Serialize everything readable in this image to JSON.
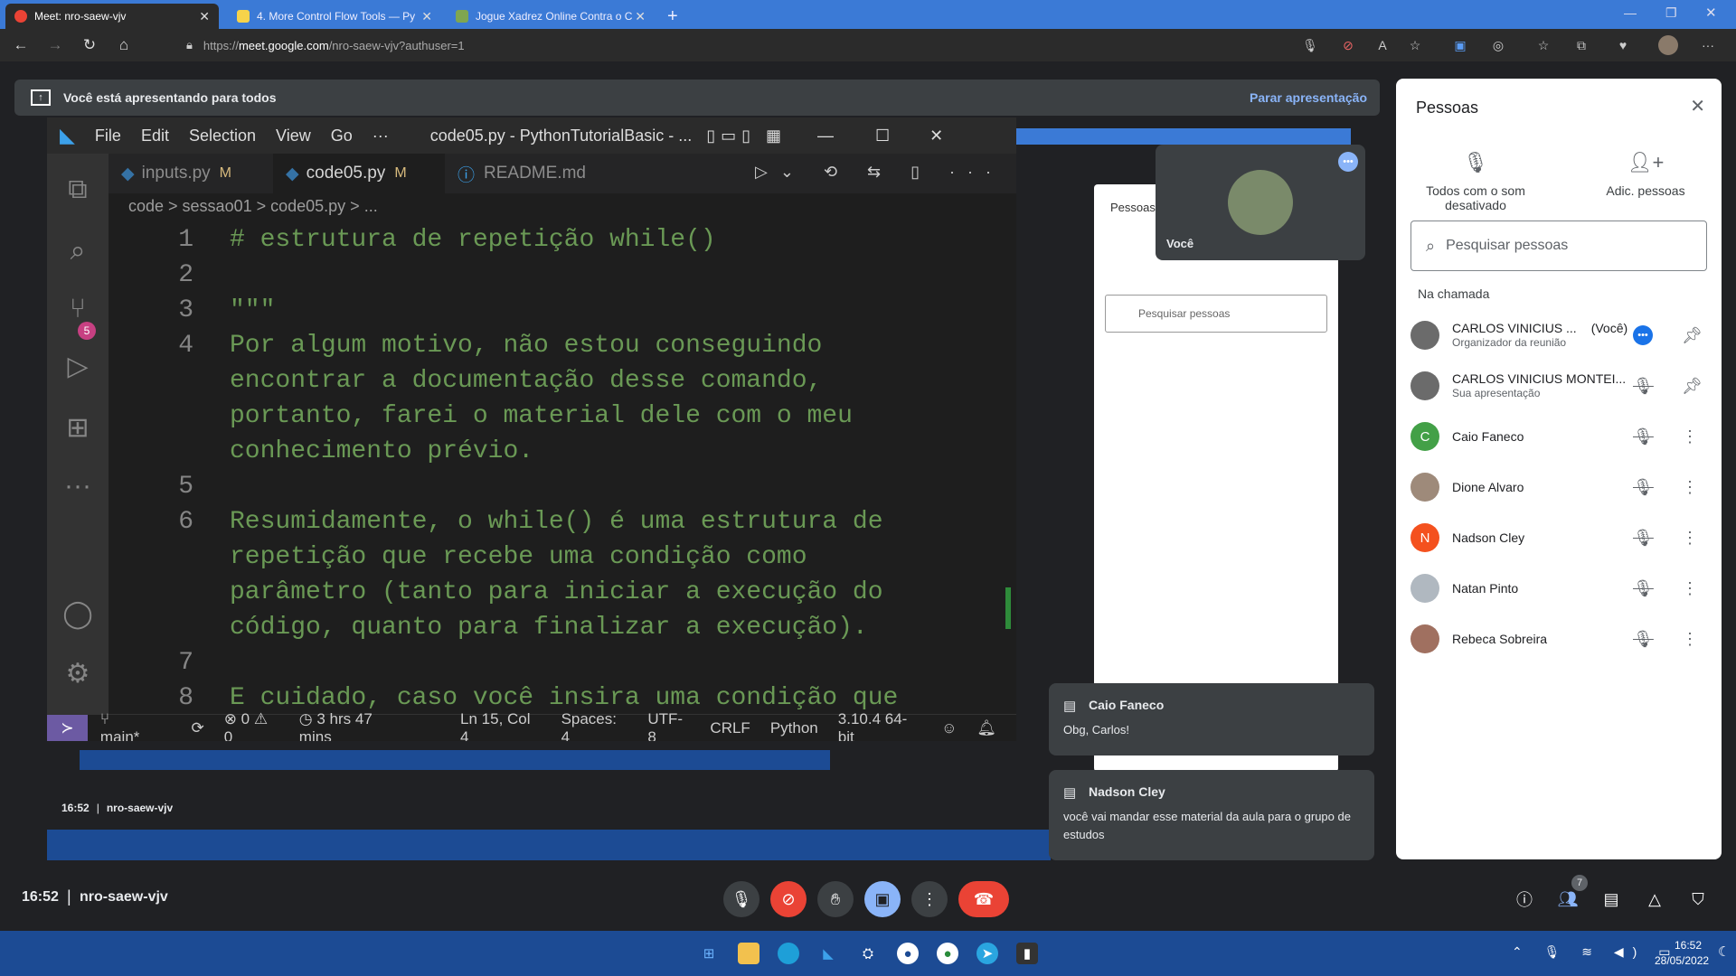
{
  "browser": {
    "tabs": [
      {
        "title": "Meet: nro-saew-vjv",
        "active": true
      },
      {
        "title": "4. More Control Flow Tools — Py"
      },
      {
        "title": "Jogue Xadrez Online Contra o C"
      }
    ],
    "url_prefix": "https://",
    "url_domain": "meet.google.com",
    "url_path": "/nro-saew-vjv?authuser=1"
  },
  "banner": {
    "text": "Você está apresentando para todos",
    "stop": "Parar apresentação"
  },
  "vscode": {
    "menu": [
      "File",
      "Edit",
      "Selection",
      "View",
      "Go",
      "···"
    ],
    "window_title": "code05.py - PythonTutorialBasic - ...",
    "tabs": [
      {
        "label": "inputs.py",
        "badge": "M"
      },
      {
        "label": "code05.py",
        "badge": "M",
        "active": true
      },
      {
        "label": "README.md",
        "badge": ""
      }
    ],
    "breadcrumb": "code > sessao01 > code05.py > ...",
    "scm_badge": "5",
    "lines": [
      {
        "n": "1",
        "text": "# estrutura de repetição while()"
      },
      {
        "n": "2",
        "text": ""
      },
      {
        "n": "3",
        "text": "\"\"\""
      },
      {
        "n": "4",
        "text": "Por algum motivo, não estou conseguindo"
      },
      {
        "n": "",
        "text": "encontrar a documentação desse comando,"
      },
      {
        "n": "",
        "text": "portanto, farei o material dele com o meu"
      },
      {
        "n": "",
        "text": "conhecimento prévio."
      },
      {
        "n": "5",
        "text": ""
      },
      {
        "n": "6",
        "text": "Resumidamente, o while() é uma estrutura de"
      },
      {
        "n": "",
        "text": "repetição que recebe uma condição como"
      },
      {
        "n": "",
        "text": "parâmetro (tanto para iniciar a execução do"
      },
      {
        "n": "",
        "text": "código, quanto para finalizar a execução)."
      },
      {
        "n": "7",
        "text": ""
      },
      {
        "n": "8",
        "text": "E cuidado, caso você insira uma condição que"
      }
    ],
    "status": {
      "branch": "main*",
      "problems": "⊗ 0 ⚠ 0",
      "time": "3 hrs 47 mins",
      "position": "Ln 15, Col 4",
      "spaces": "Spaces: 4",
      "encoding": "UTF-8",
      "eol": "CRLF",
      "language": "Python",
      "interpreter": "3.10.4 64-bit"
    }
  },
  "voce_tile": {
    "label": "Você"
  },
  "mini_meet": {
    "time": "16:52",
    "code": "nro-saew-vjv"
  },
  "people": {
    "title": "Pessoas",
    "mute_all": "Todos com o som desativado",
    "add": "Adic. pessoas",
    "search_placeholder": "Pesquisar pessoas",
    "section": "Na chamada",
    "list": [
      {
        "name": "CARLOS VINICIUS ...",
        "tag": "(Você)",
        "sub": "Organizador da reunião",
        "color": "#6b6b6b"
      },
      {
        "name": "CARLOS VINICIUS MONTEI...",
        "tag": "",
        "sub": "Sua apresentação",
        "color": "#6b6b6b"
      },
      {
        "name": "Caio Faneco",
        "tag": "",
        "sub": "",
        "initial": "C",
        "color": "#43a047"
      },
      {
        "name": "Dione Alvaro",
        "tag": "",
        "sub": "",
        "color": "#9e8a7a"
      },
      {
        "name": "Nadson Cley",
        "tag": "",
        "sub": "",
        "initial": "N",
        "color": "#f4511e"
      },
      {
        "name": "Natan Pinto",
        "tag": "",
        "sub": "",
        "color": "#b0b8c0"
      },
      {
        "name": "Rebeca Sobreira",
        "tag": "",
        "sub": "",
        "color": "#a07060"
      }
    ]
  },
  "chat": [
    {
      "sender": "Caio Faneco",
      "message": "Obg, Carlos!"
    },
    {
      "sender": "Nadson Cley",
      "message": "você vai mandar esse material da aula para o grupo de estudos"
    }
  ],
  "meet_bar": {
    "time": "16:52",
    "code": "nro-saew-vjv",
    "participants_count": "7"
  },
  "taskbar": {
    "time": "16:52",
    "date": "28/05/2022"
  }
}
